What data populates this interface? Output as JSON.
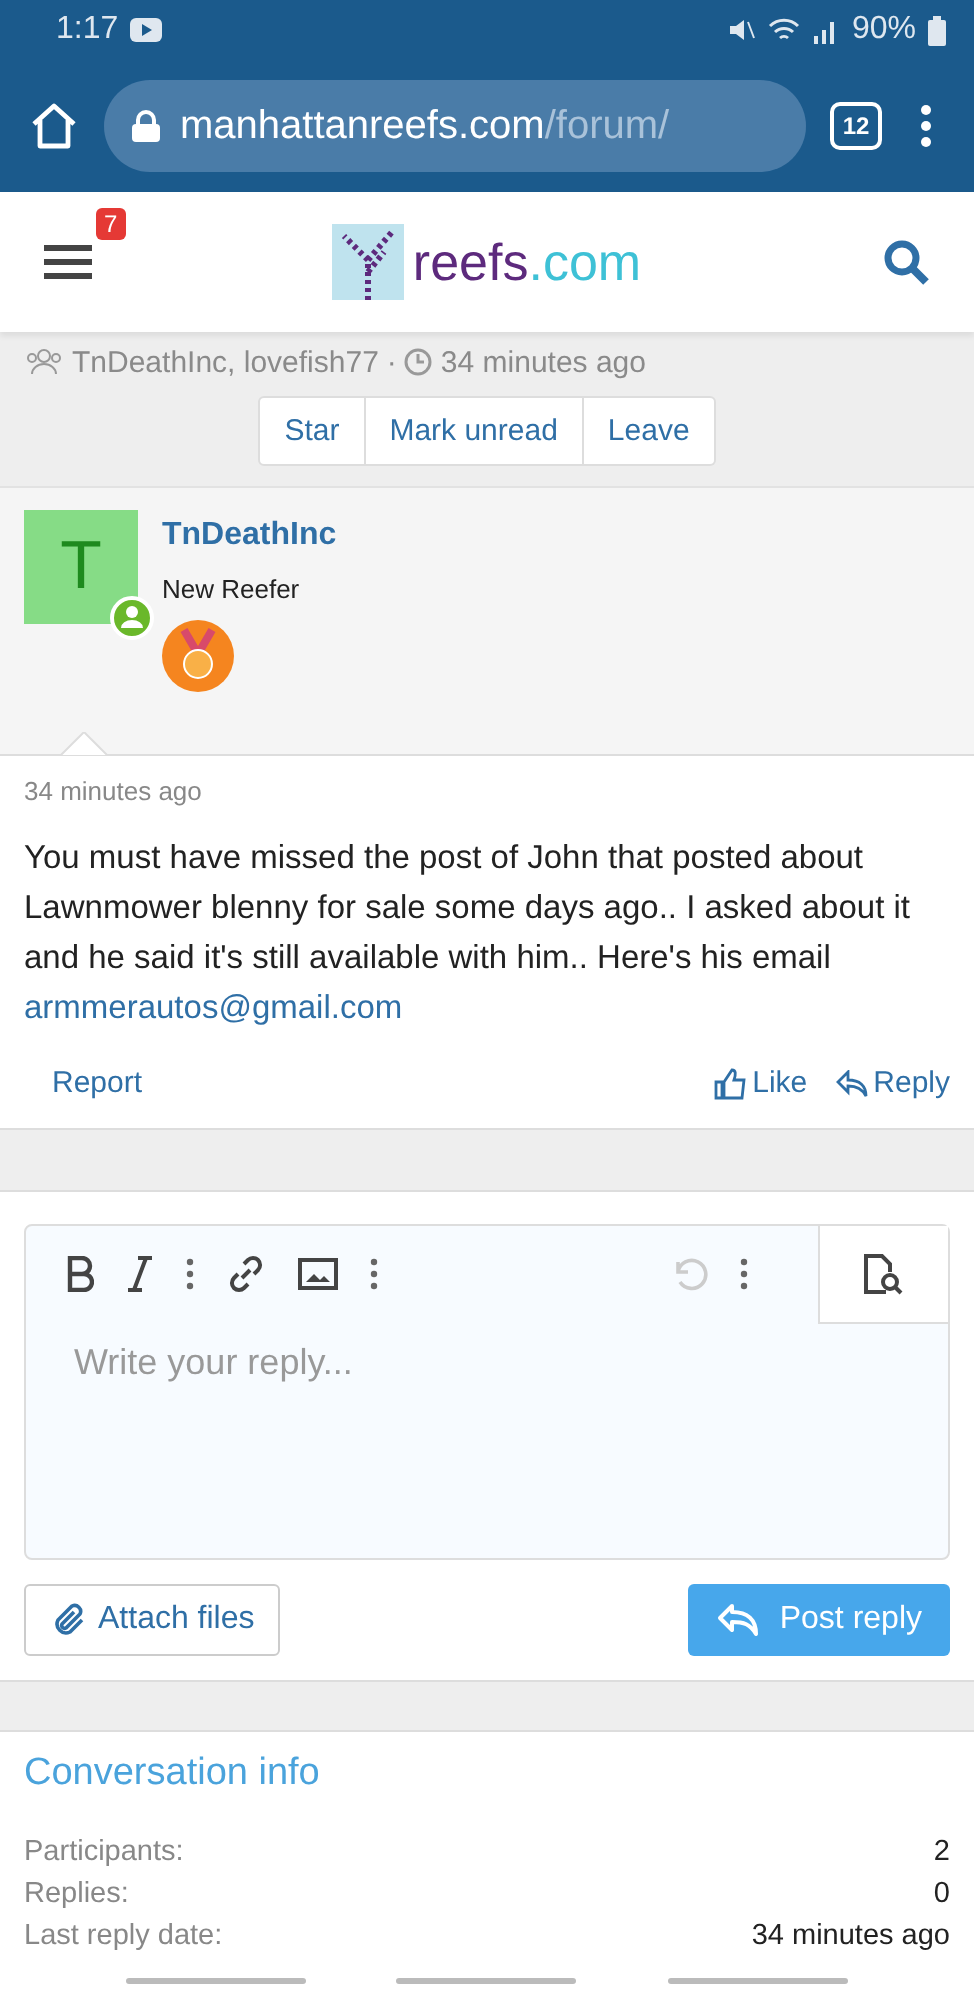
{
  "status_bar": {
    "time": "1:17",
    "battery": "90%"
  },
  "browser": {
    "url_host": "manhattanreefs.com",
    "url_path": "/forum/",
    "tab_count": "12"
  },
  "header": {
    "notification_count": "7",
    "logo_word": "reefs",
    "logo_suffix": ".com"
  },
  "conversation": {
    "participants": "TnDeathInc, lovefish77",
    "separator": "·",
    "time": "34 minutes ago"
  },
  "actions": [
    "Star",
    "Mark unread",
    "Leave"
  ],
  "message": {
    "author": "TnDeathInc",
    "avatar_letter": "T",
    "online": true,
    "user_title": "New Reefer",
    "date": "34 minutes ago",
    "body": "You must have missed the post of John that posted about Lawnmower blenny for sale some days ago.. I asked about it and he said it's still available with him.. Here's his email",
    "email": "armmerautos@gmail.com",
    "report": "Report",
    "like": "Like",
    "reply": "Reply"
  },
  "editor": {
    "placeholder": "Write your reply...",
    "undo_disabled": true,
    "attach": "Attach files",
    "post": "Post reply"
  },
  "info": {
    "title": "Conversation info",
    "rows": [
      {
        "label": "Participants:",
        "value": "2"
      },
      {
        "label": "Replies:",
        "value": "0"
      },
      {
        "label": "Last reply date:",
        "value": "34 minutes ago"
      }
    ]
  }
}
